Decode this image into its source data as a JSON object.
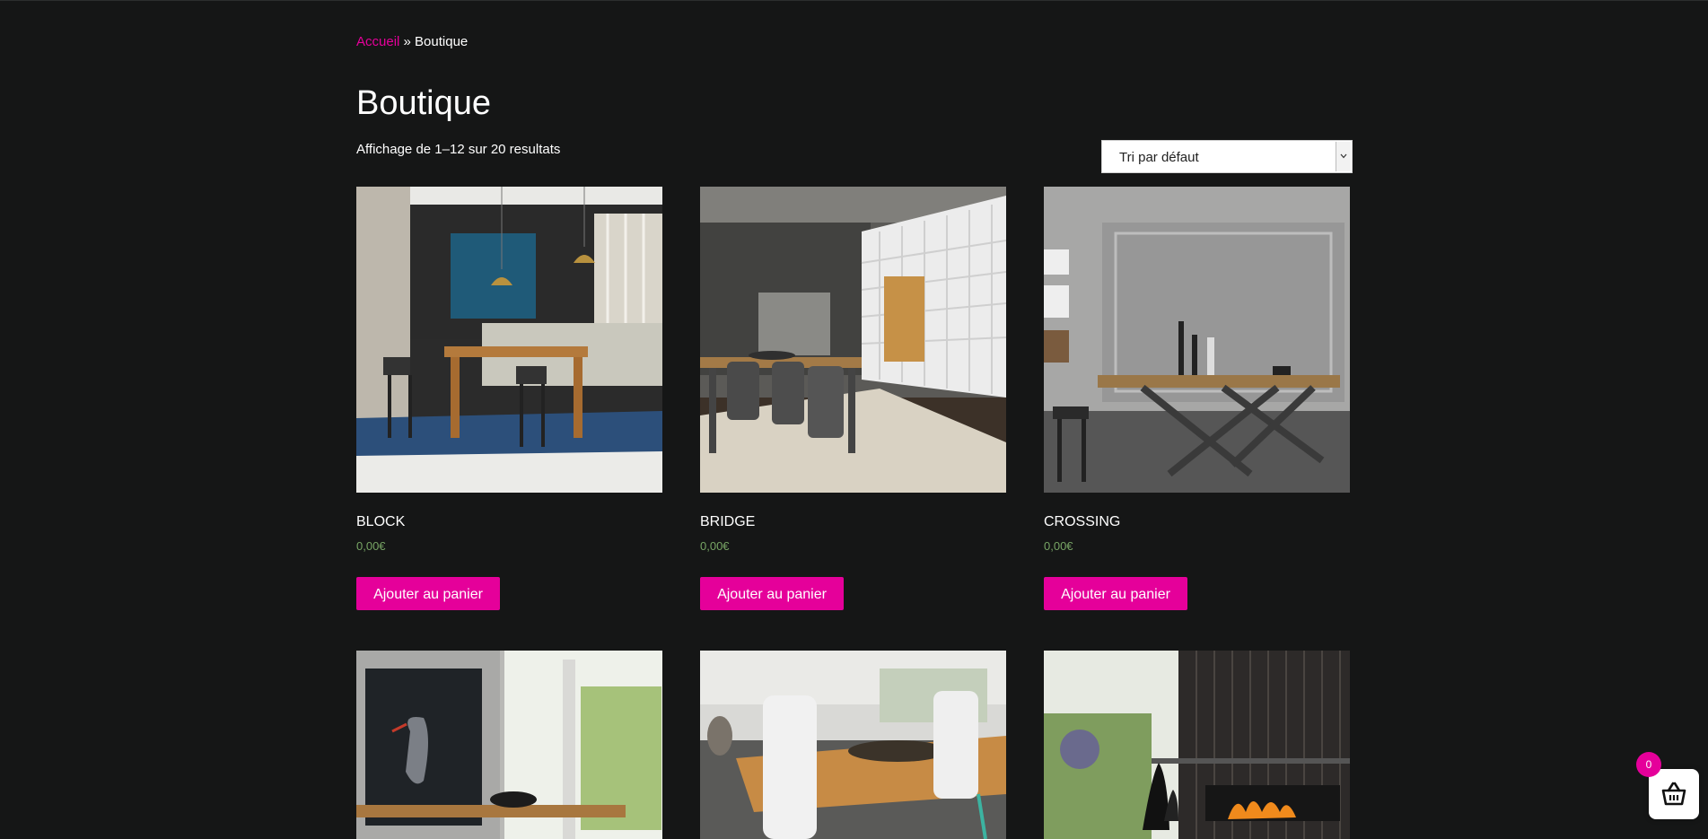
{
  "breadcrumb": {
    "home": "Accueil",
    "separator": "»",
    "current": "Boutique"
  },
  "page": {
    "title": "Boutique"
  },
  "results": {
    "count_text": "Affichage de 1–12 sur 20 resultats"
  },
  "ordering": {
    "selected": "Tri par défaut"
  },
  "products": [
    {
      "name": "BLOCK",
      "price": "0,00€",
      "button": "Ajouter au panier"
    },
    {
      "name": "BRIDGE",
      "price": "0,00€",
      "button": "Ajouter au panier"
    },
    {
      "name": "CROSSING",
      "price": "0,00€",
      "button": "Ajouter au panier"
    }
  ],
  "cart": {
    "count": "0"
  },
  "colors": {
    "accent": "#e5009a",
    "background": "#151616",
    "price": "#77a464"
  }
}
